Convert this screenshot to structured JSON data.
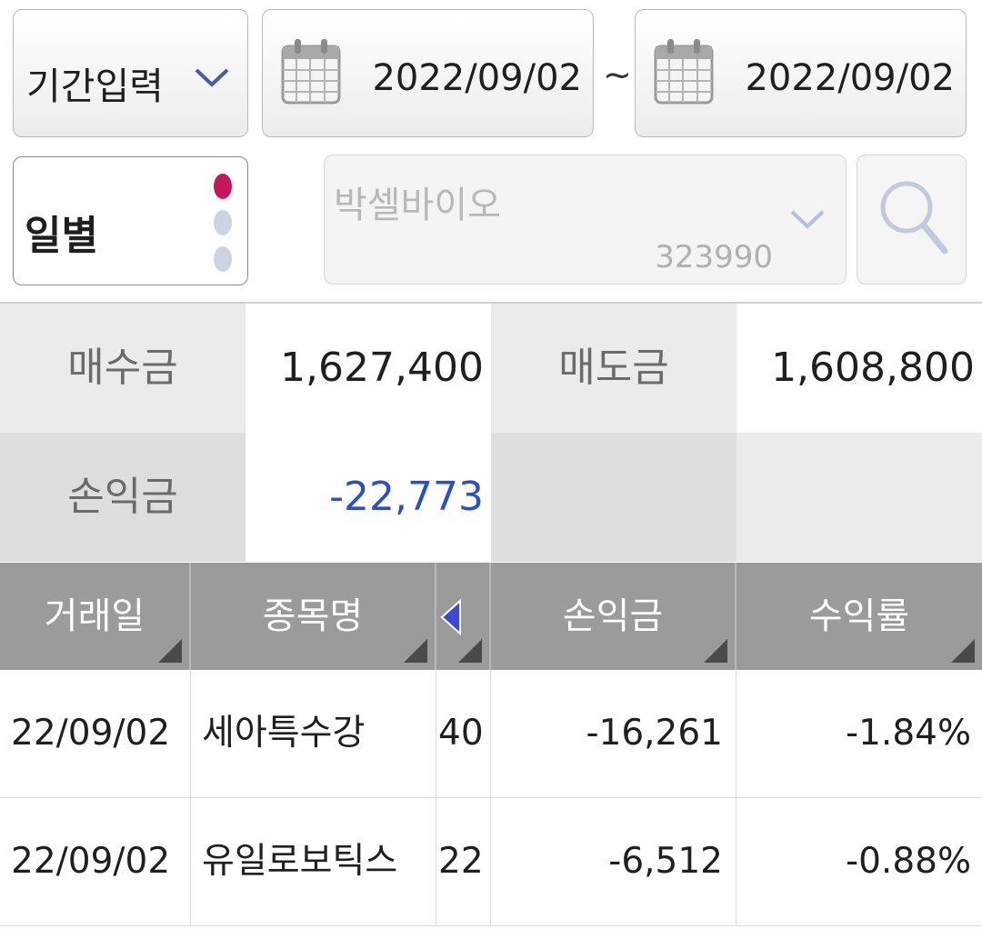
{
  "filter": {
    "period_label": "기간입력",
    "start_date": "2022/09/02",
    "separator": "~",
    "end_date": "2022/09/02",
    "daily_label": "일별",
    "stock_name": "박셀바이오",
    "stock_code": "323990"
  },
  "summary": {
    "buy_label": "매수금",
    "buy_value": "1,627,400",
    "sell_label": "매도금",
    "sell_value": "1,608,800",
    "pnl_label": "손익금",
    "pnl_value": "-22,773"
  },
  "table": {
    "headers": [
      "거래일",
      "종목명",
      "손익금",
      "수익률"
    ],
    "rows": [
      {
        "date": "22/09/02",
        "name": "세아특수강",
        "qty": "40",
        "pnl": "-16,261",
        "rate": "-1.84%"
      },
      {
        "date": "22/09/02",
        "name": "유일로보틱스",
        "qty": "22",
        "pnl": "-6,512",
        "rate": "-0.88%"
      }
    ]
  },
  "colors": {
    "negative": "#2a4fc7",
    "active_dot": "#c2185b",
    "inactive_dot": "#cdd3e2",
    "header_bg": "#9b9b9b"
  }
}
